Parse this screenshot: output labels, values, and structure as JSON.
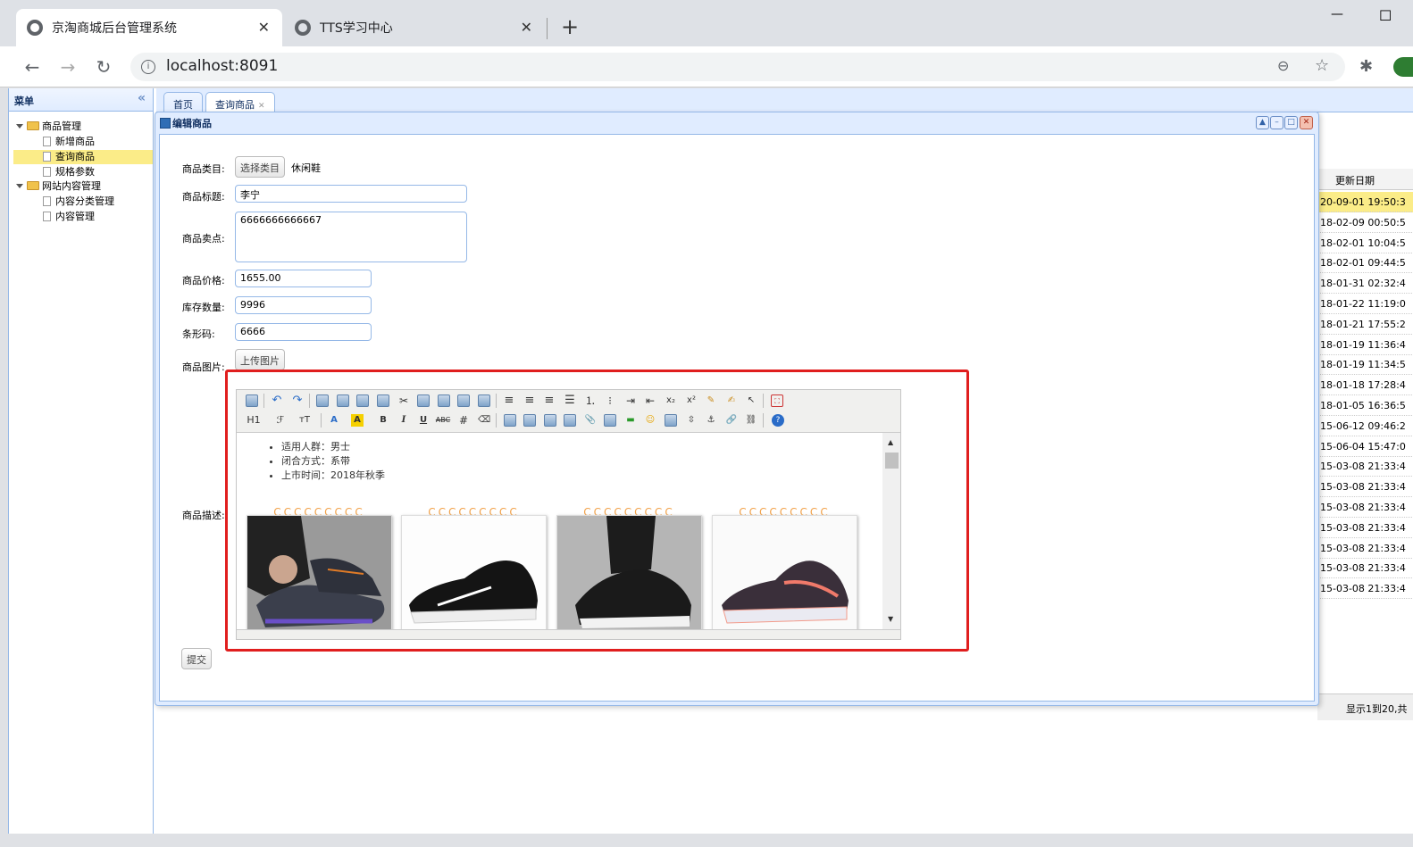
{
  "browser": {
    "tabs": [
      {
        "label": "京淘商城后台管理系统",
        "close": "✕"
      },
      {
        "label": "TTS学习中心",
        "close": "✕"
      }
    ],
    "new_tab": "+",
    "url": "localhost:8091",
    "nav": {
      "back": "←",
      "forward": "→",
      "reload": "↻"
    },
    "window_controls": {
      "minimize": "—",
      "maximize": "☐"
    }
  },
  "sidebar": {
    "title": "菜单",
    "collapse": "«",
    "tree": [
      {
        "label": "商品管理",
        "type": "folder"
      },
      {
        "label": "新增商品",
        "type": "file"
      },
      {
        "label": "查询商品",
        "type": "file",
        "selected": true
      },
      {
        "label": "规格参数",
        "type": "file"
      },
      {
        "label": "网站内容管理",
        "type": "folder"
      },
      {
        "label": "内容分类管理",
        "type": "file"
      },
      {
        "label": "内容管理",
        "type": "file"
      }
    ]
  },
  "content_tabs": [
    {
      "label": "首页"
    },
    {
      "label": "查询商品",
      "close": "✕"
    }
  ],
  "background_grid": {
    "header": "更新日期",
    "rows": [
      "20-09-01 19:50:3",
      "18-02-09 00:50:5",
      "18-02-01 10:04:5",
      "18-02-01 09:44:5",
      "18-01-31 02:32:4",
      "18-01-22 11:19:0",
      "18-01-21 17:55:2",
      "18-01-19 11:36:4",
      "18-01-19 11:34:5",
      "18-01-18 17:28:4",
      "18-01-05 16:36:5",
      "15-06-12 09:46:2",
      "15-06-04 15:47:0",
      "15-03-08 21:33:4",
      "15-03-08 21:33:4",
      "15-03-08 21:33:4",
      "15-03-08 21:33:4",
      "15-03-08 21:33:4",
      "15-03-08 21:33:4",
      "15-03-08 21:33:4"
    ],
    "pager": "显示1到20,共"
  },
  "edit_window": {
    "title": "编辑商品",
    "form": {
      "category_label": "商品类目:",
      "category_button": "选择类目",
      "category_value": "休闲鞋",
      "title_label": "商品标题:",
      "title_value": "李宁",
      "sellpoint_label": "商品卖点:",
      "sellpoint_value": "6666666666667",
      "price_label": "商品价格:",
      "price_value": "1655.00",
      "stock_label": "库存数量:",
      "stock_value": "9996",
      "barcode_label": "条形码:",
      "barcode_value": "6666",
      "image_label": "商品图片:",
      "upload_button": "上传图片",
      "desc_label": "商品描述:",
      "submit_button": "提交"
    },
    "editor": {
      "toolbar_row2_text": {
        "heading": "H1",
        "font": "ℱ",
        "size": "ᴛT"
      },
      "list_items": [
        "适用人群：男士",
        "闭合方式：系带",
        "上市时间：2018年秋季"
      ]
    }
  },
  "colors": {
    "panel_border": "#95b8e7",
    "highlight": "#fbec88",
    "annotation_red": "#e01e1e"
  }
}
